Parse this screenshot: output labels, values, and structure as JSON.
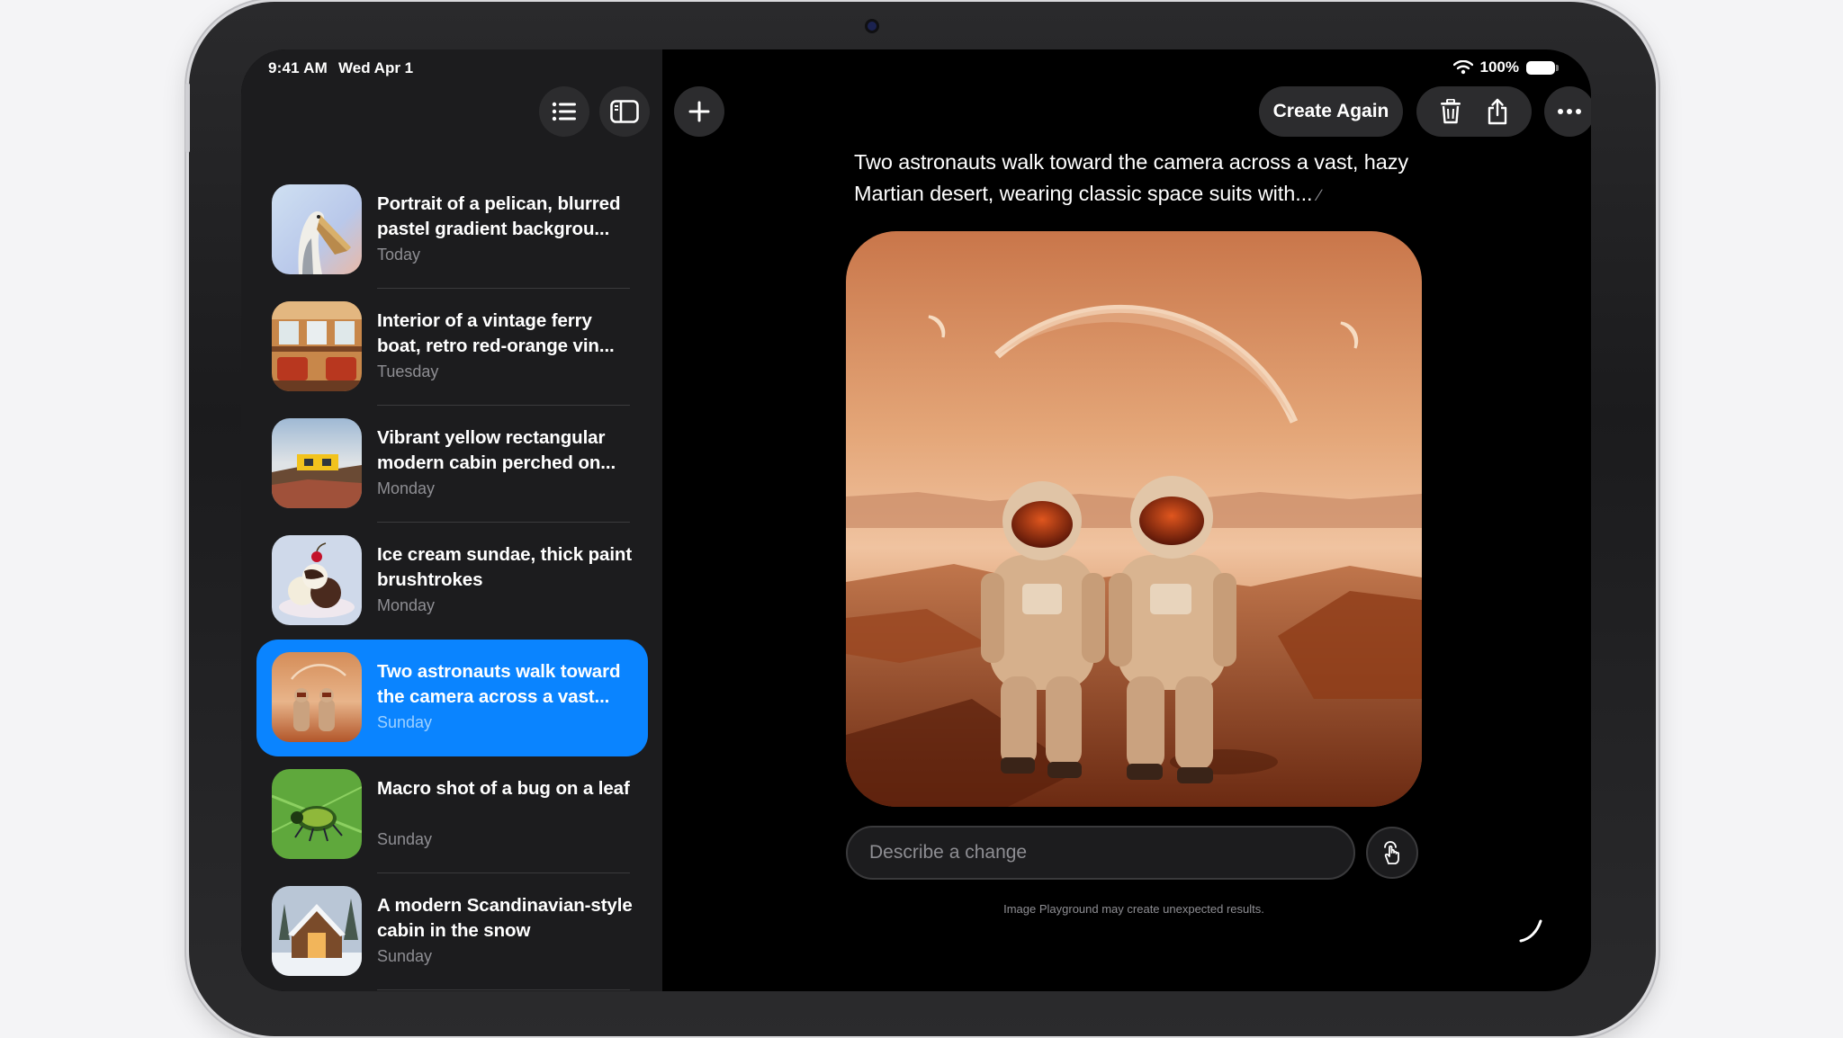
{
  "status": {
    "time": "9:41 AM",
    "date": "Wed Apr 1",
    "battery": "100%"
  },
  "sidebar": {
    "items": [
      {
        "title": "Portrait of a pelican, blurred pastel gradient backgrou...",
        "date": "Today",
        "thumb": "pelican"
      },
      {
        "title": "Interior of a vintage ferry boat, retro red-orange vin...",
        "date": "Tuesday",
        "thumb": "ferry"
      },
      {
        "title": "Vibrant yellow rectangular modern cabin perched on...",
        "date": "Monday",
        "thumb": "cabin-yellow"
      },
      {
        "title": "Ice cream sundae, thick paint brushtrokes",
        "date": "Monday",
        "thumb": "sundae"
      },
      {
        "title": "Two astronauts walk toward the camera across a vast...",
        "date": "Sunday",
        "thumb": "astronauts",
        "selected": true
      },
      {
        "title": "Macro shot of a bug on a leaf",
        "date": "Sunday",
        "thumb": "bug"
      },
      {
        "title": "A modern Scandinavian-style cabin in the snow",
        "date": "Sunday",
        "thumb": "snow-cabin"
      }
    ]
  },
  "toolbar": {
    "create_again": "Create Again"
  },
  "main": {
    "prompt": "Two astronauts walk toward the camera across a vast, hazy Martian desert, wearing classic space suits with...",
    "input_placeholder": "Describe a change",
    "disclaimer": "Image Playground may create unexpected results."
  },
  "colors": {
    "accent": "#0a84ff",
    "sidebar_bg": "#1c1c1e",
    "screen_bg": "#000000",
    "button_bg": "#2c2c2e"
  }
}
